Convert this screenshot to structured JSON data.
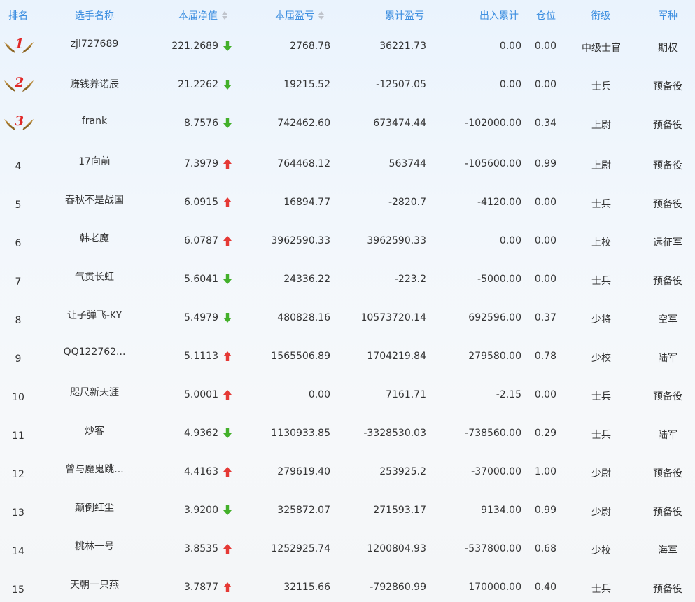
{
  "headers": {
    "rank": "排名",
    "name": "选手名称",
    "nav": "本届净值",
    "pnl": "本届盈亏",
    "cumulative": "累计盈亏",
    "flow": "出入累计",
    "position": "仓位",
    "title": "衔级",
    "arm": "军种"
  },
  "colors": {
    "header_text": "#3c8ee0",
    "up_arrow": "#e53935",
    "down_arrow": "#43b02a",
    "medal_number": "#e12828",
    "medal_wing": "#c9953e"
  },
  "rows": [
    {
      "rank": "1",
      "medal": true,
      "name": "zjl727689",
      "nav": "221.2689",
      "trend": "down",
      "pnl": "2768.78",
      "cumulative": "36221.73",
      "flow": "0.00",
      "position": "0.00",
      "title": "中级士官",
      "arm": "期权"
    },
    {
      "rank": "2",
      "medal": true,
      "name": "赚钱养诺辰",
      "nav": "21.2262",
      "trend": "down",
      "pnl": "19215.52",
      "cumulative": "-12507.05",
      "flow": "0.00",
      "position": "0.00",
      "title": "士兵",
      "arm": "预备役"
    },
    {
      "rank": "3",
      "medal": true,
      "name": "frank",
      "nav": "8.7576",
      "trend": "down",
      "pnl": "742462.60",
      "cumulative": "673474.44",
      "flow": "-102000.00",
      "position": "0.34",
      "title": "上尉",
      "arm": "预备役"
    },
    {
      "rank": "4",
      "medal": false,
      "name": "17向前",
      "nav": "7.3979",
      "trend": "up",
      "pnl": "764468.12",
      "cumulative": "563744",
      "flow": "-105600.00",
      "position": "0.99",
      "title": "上尉",
      "arm": "预备役"
    },
    {
      "rank": "5",
      "medal": false,
      "name": "春秋不是战国",
      "nav": "6.0915",
      "trend": "up",
      "pnl": "16894.77",
      "cumulative": "-2820.7",
      "flow": "-4120.00",
      "position": "0.00",
      "title": "士兵",
      "arm": "预备役"
    },
    {
      "rank": "6",
      "medal": false,
      "name": "韩老魔",
      "nav": "6.0787",
      "trend": "up",
      "pnl": "3962590.33",
      "cumulative": "3962590.33",
      "flow": "0.00",
      "position": "0.00",
      "title": "上校",
      "arm": "远征军"
    },
    {
      "rank": "7",
      "medal": false,
      "name": "气贯长虹",
      "nav": "5.6041",
      "trend": "down",
      "pnl": "24336.22",
      "cumulative": "-223.2",
      "flow": "-5000.00",
      "position": "0.00",
      "title": "士兵",
      "arm": "预备役"
    },
    {
      "rank": "8",
      "medal": false,
      "name": "让子弹飞-KY",
      "nav": "5.4979",
      "trend": "down",
      "pnl": "480828.16",
      "cumulative": "10573720.14",
      "flow": "692596.00",
      "position": "0.37",
      "title": "少将",
      "arm": "空军"
    },
    {
      "rank": "9",
      "medal": false,
      "name": "QQ122762...",
      "nav": "5.1113",
      "trend": "up",
      "pnl": "1565506.89",
      "cumulative": "1704219.84",
      "flow": "279580.00",
      "position": "0.78",
      "title": "少校",
      "arm": "陆军"
    },
    {
      "rank": "10",
      "medal": false,
      "name": "咫尺新天涯",
      "nav": "5.0001",
      "trend": "up",
      "pnl": "0.00",
      "cumulative": "7161.71",
      "flow": "-2.15",
      "position": "0.00",
      "title": "士兵",
      "arm": "预备役"
    },
    {
      "rank": "11",
      "medal": false,
      "name": "炒客",
      "nav": "4.9362",
      "trend": "down",
      "pnl": "1130933.85",
      "cumulative": "-3328530.03",
      "flow": "-738560.00",
      "position": "0.29",
      "title": "士兵",
      "arm": "陆军"
    },
    {
      "rank": "12",
      "medal": false,
      "name": "曾与魔鬼跳...",
      "nav": "4.4163",
      "trend": "up",
      "pnl": "279619.40",
      "cumulative": "253925.2",
      "flow": "-37000.00",
      "position": "1.00",
      "title": "少尉",
      "arm": "预备役"
    },
    {
      "rank": "13",
      "medal": false,
      "name": "颠倒红尘",
      "nav": "3.9200",
      "trend": "down",
      "pnl": "325872.07",
      "cumulative": "271593.17",
      "flow": "9134.00",
      "position": "0.99",
      "title": "少尉",
      "arm": "预备役"
    },
    {
      "rank": "14",
      "medal": false,
      "name": "桃林一号",
      "nav": "3.8535",
      "trend": "up",
      "pnl": "1252925.74",
      "cumulative": "1200804.93",
      "flow": "-537800.00",
      "position": "0.68",
      "title": "少校",
      "arm": "海军"
    },
    {
      "rank": "15",
      "medal": false,
      "name": "天朝一只燕",
      "nav": "3.7877",
      "trend": "up",
      "pnl": "32115.66",
      "cumulative": "-792860.99",
      "flow": "170000.00",
      "position": "0.40",
      "title": "士兵",
      "arm": "预备役"
    }
  ]
}
